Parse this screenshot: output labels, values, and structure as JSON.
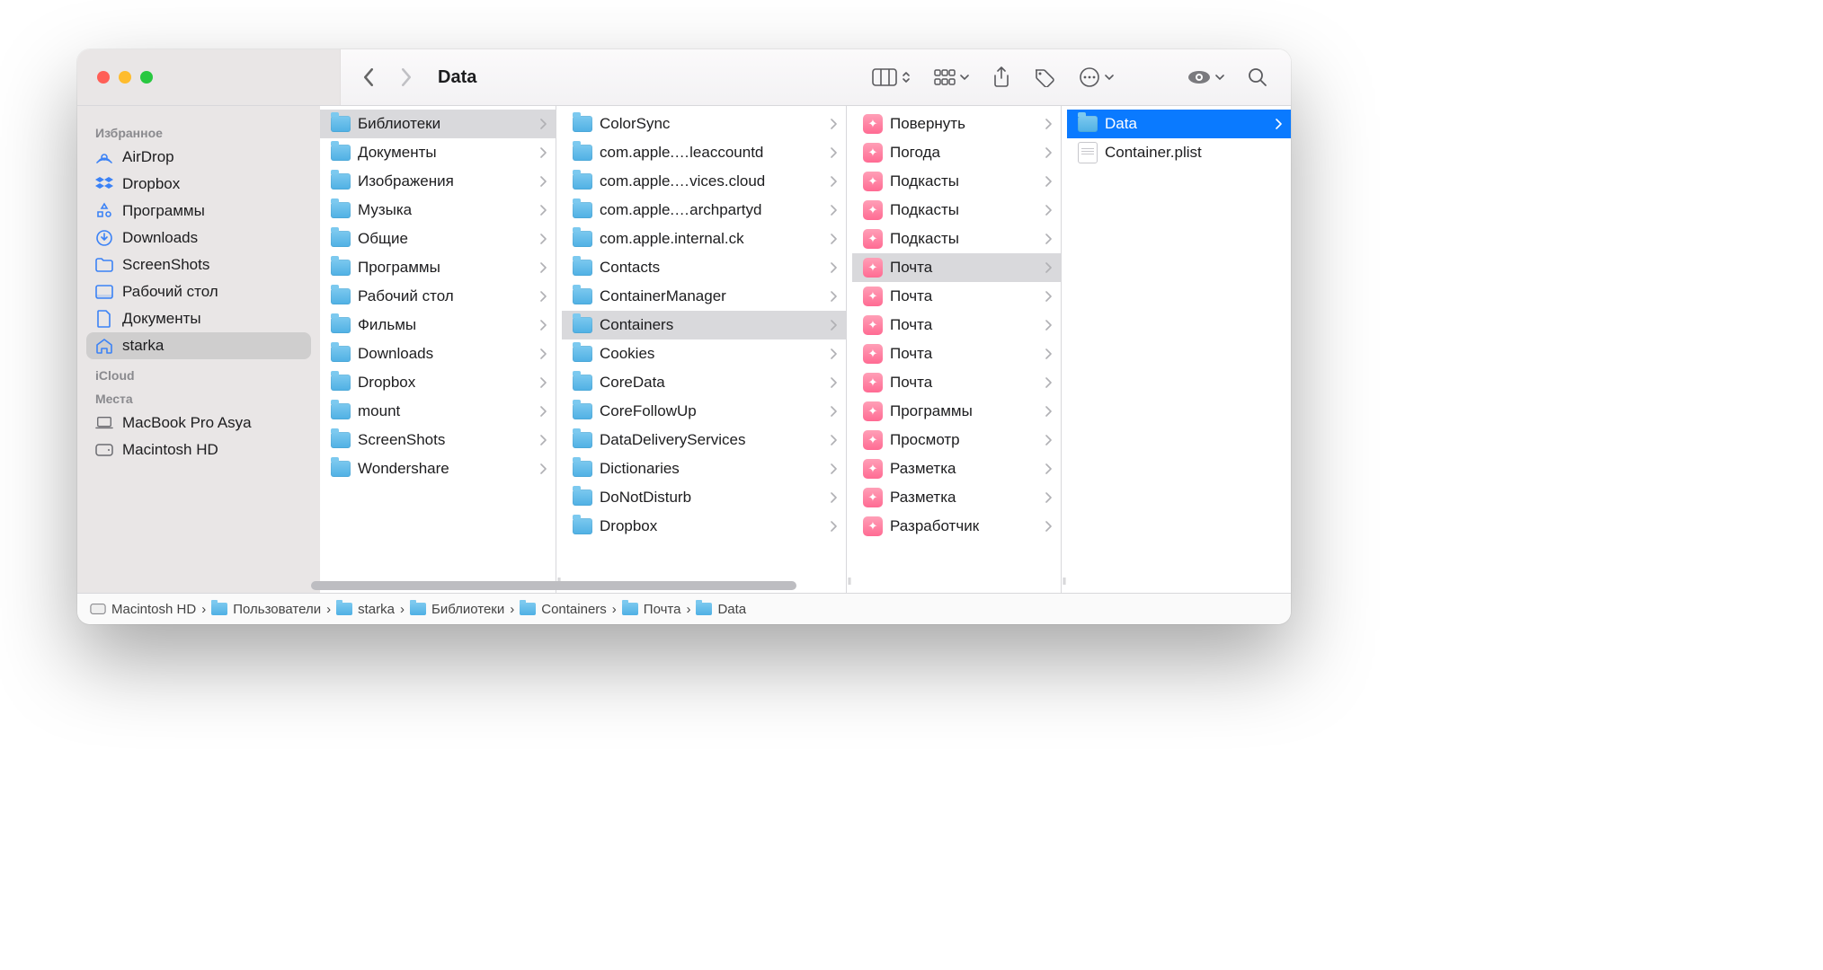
{
  "window": {
    "title": "Data"
  },
  "traffic": {
    "close": "#ff5f57",
    "min": "#febc2e",
    "max": "#28c840"
  },
  "sidebar": {
    "sections": [
      {
        "title": "Избранное",
        "items": [
          {
            "icon": "airdrop",
            "label": "AirDrop"
          },
          {
            "icon": "dropbox",
            "label": "Dropbox"
          },
          {
            "icon": "apps",
            "label": "Программы"
          },
          {
            "icon": "downloads",
            "label": "Downloads"
          },
          {
            "icon": "folder",
            "label": "ScreenShots"
          },
          {
            "icon": "desktop",
            "label": "Рабочий стол"
          },
          {
            "icon": "doc",
            "label": "Документы"
          },
          {
            "icon": "home",
            "label": "starka",
            "selected": true
          }
        ]
      },
      {
        "title": "iCloud",
        "items": []
      },
      {
        "title": "Места",
        "items": [
          {
            "icon": "laptop",
            "label": "MacBook Pro Asya",
            "gray": true
          },
          {
            "icon": "disk",
            "label": "Macintosh HD",
            "gray": true
          }
        ]
      }
    ]
  },
  "columns": [
    {
      "scrollTop": 0,
      "items": [
        {
          "t": "folder",
          "n": "Библиотеки",
          "sel": true
        },
        {
          "t": "folder",
          "n": "Документы"
        },
        {
          "t": "folder",
          "n": "Изображения"
        },
        {
          "t": "folder",
          "n": "Музыка"
        },
        {
          "t": "folder",
          "n": "Общие"
        },
        {
          "t": "folder",
          "n": "Программы"
        },
        {
          "t": "folder",
          "n": "Рабочий стол"
        },
        {
          "t": "folder",
          "n": "Фильмы"
        },
        {
          "t": "folder",
          "n": "Downloads"
        },
        {
          "t": "folder",
          "n": "Dropbox"
        },
        {
          "t": "folder",
          "n": "mount"
        },
        {
          "t": "folder",
          "n": "ScreenShots"
        },
        {
          "t": "folder",
          "n": "Wondershare"
        }
      ]
    },
    {
      "scrollTop": 0,
      "items": [
        {
          "t": "folder",
          "n": "ColorSync"
        },
        {
          "t": "folder",
          "n": "com.apple.…leaccountd"
        },
        {
          "t": "folder",
          "n": "com.apple.…vices.cloud"
        },
        {
          "t": "folder",
          "n": "com.apple.…archpartyd"
        },
        {
          "t": "folder",
          "n": "com.apple.internal.ck"
        },
        {
          "t": "folder",
          "n": "Contacts"
        },
        {
          "t": "folder",
          "n": "ContainerManager"
        },
        {
          "t": "folder",
          "n": "Containers",
          "sel": true
        },
        {
          "t": "folder",
          "n": "Cookies"
        },
        {
          "t": "folder",
          "n": "CoreData"
        },
        {
          "t": "folder",
          "n": "CoreFollowUp"
        },
        {
          "t": "folder",
          "n": "DataDeliveryServices"
        },
        {
          "t": "folder",
          "n": "Dictionaries"
        },
        {
          "t": "folder",
          "n": "DoNotDisturb"
        },
        {
          "t": "folder",
          "n": "Dropbox"
        }
      ]
    },
    {
      "scrollTop": 0,
      "items": [
        {
          "t": "app",
          "n": "Повернуть"
        },
        {
          "t": "app",
          "n": "Погода"
        },
        {
          "t": "app",
          "n": "Подкасты"
        },
        {
          "t": "app",
          "n": "Подкасты"
        },
        {
          "t": "app",
          "n": "Подкасты"
        },
        {
          "t": "app",
          "n": "Почта",
          "sel": true
        },
        {
          "t": "app",
          "n": "Почта"
        },
        {
          "t": "app",
          "n": "Почта"
        },
        {
          "t": "app",
          "n": "Почта"
        },
        {
          "t": "app",
          "n": "Почта"
        },
        {
          "t": "app",
          "n": "Программы"
        },
        {
          "t": "app",
          "n": "Просмотр"
        },
        {
          "t": "app",
          "n": "Разметка"
        },
        {
          "t": "app",
          "n": "Разметка"
        },
        {
          "t": "app",
          "n": "Разработчик"
        }
      ]
    },
    {
      "scrollTop": 0,
      "items": [
        {
          "t": "folder",
          "n": "Data",
          "accent": true,
          "chev": true
        },
        {
          "t": "file",
          "n": "Container.plist"
        }
      ]
    }
  ],
  "path": [
    {
      "icon": "disk",
      "label": "Macintosh HD"
    },
    {
      "icon": "folder",
      "label": "Пользователи"
    },
    {
      "icon": "folder",
      "label": "starka"
    },
    {
      "icon": "folder",
      "label": "Библиотеки"
    },
    {
      "icon": "folder",
      "label": "Containers"
    },
    {
      "icon": "folder",
      "label": "Почта"
    },
    {
      "icon": "folder",
      "label": "Data"
    }
  ]
}
